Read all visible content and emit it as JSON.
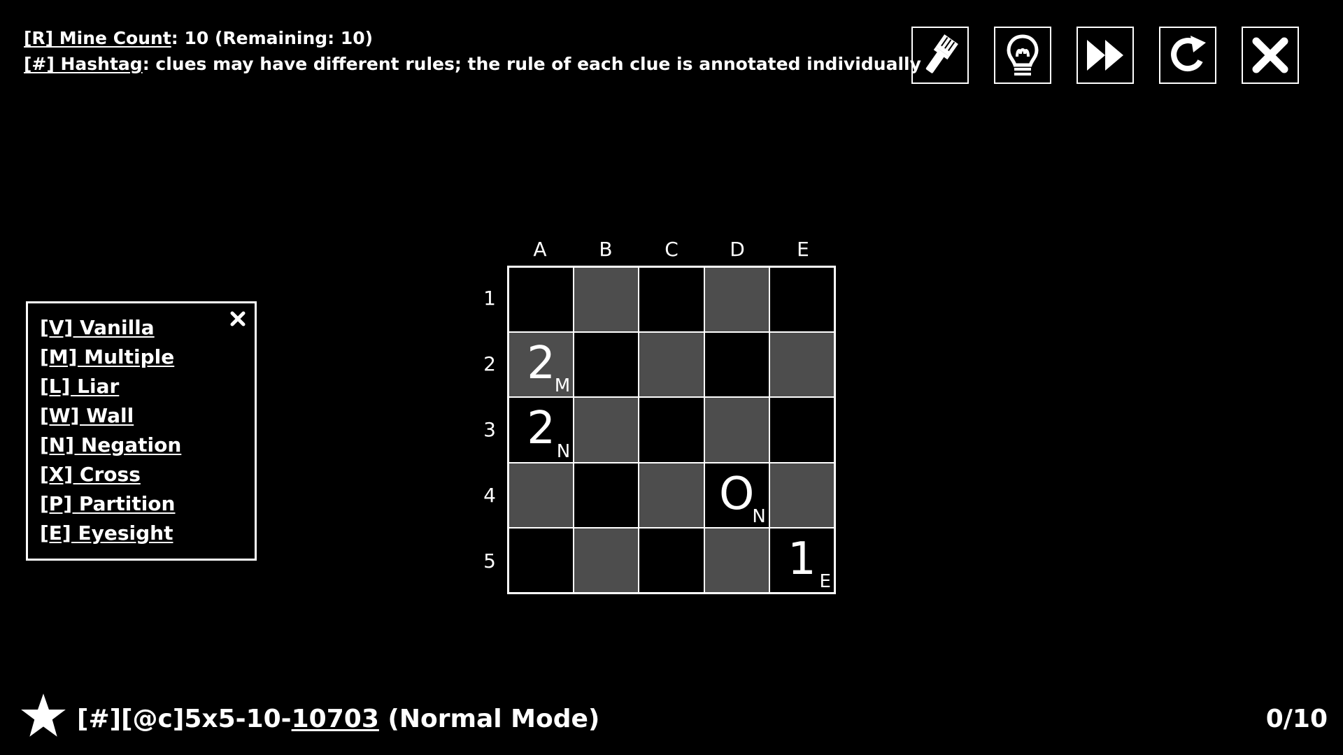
{
  "rules": {
    "line1_tag": "[R] Mine Count",
    "line1_rest": ":  10 (Remaining: 10)",
    "line2_tag": "[#] Hashtag",
    "line2_rest": ": clues may have different rules; the rule of each clue is annotated individually"
  },
  "toolbar": {
    "icons": [
      "brush-icon",
      "lightbulb-icon",
      "fast-forward-icon",
      "restart-icon",
      "close-icon"
    ]
  },
  "legend": {
    "items": [
      "[V] Vanilla",
      "[M] Multiple",
      "[L] Liar",
      "[W] Wall",
      "[N] Negation",
      "[X] Cross",
      "[P] Partition",
      "[E] Eyesight"
    ],
    "close_icon": "close-icon"
  },
  "board": {
    "columns": [
      "A",
      "B",
      "C",
      "D",
      "E"
    ],
    "rows": [
      "1",
      "2",
      "3",
      "4",
      "5"
    ],
    "cells": [
      [
        {
          "s": "dark"
        },
        {
          "s": "gray"
        },
        {
          "s": "dark"
        },
        {
          "s": "gray"
        },
        {
          "s": "dark"
        }
      ],
      [
        {
          "s": "gray",
          "n": "2",
          "r": "M"
        },
        {
          "s": "dark"
        },
        {
          "s": "gray"
        },
        {
          "s": "dark"
        },
        {
          "s": "gray"
        }
      ],
      [
        {
          "s": "dark",
          "n": "2",
          "r": "N"
        },
        {
          "s": "gray"
        },
        {
          "s": "dark"
        },
        {
          "s": "gray"
        },
        {
          "s": "dark"
        }
      ],
      [
        {
          "s": "gray"
        },
        {
          "s": "dark"
        },
        {
          "s": "gray"
        },
        {
          "s": "dark",
          "n": "O",
          "r": "N"
        },
        {
          "s": "gray"
        }
      ],
      [
        {
          "s": "dark"
        },
        {
          "s": "gray"
        },
        {
          "s": "dark"
        },
        {
          "s": "gray"
        },
        {
          "s": "dark",
          "n": "1",
          "r": "E"
        }
      ]
    ]
  },
  "footer": {
    "prefix": "[#][@c]5x5-10-",
    "id": "10703",
    "mode": " (Normal Mode)",
    "progress": "0/10",
    "star_icon": "star-icon"
  }
}
